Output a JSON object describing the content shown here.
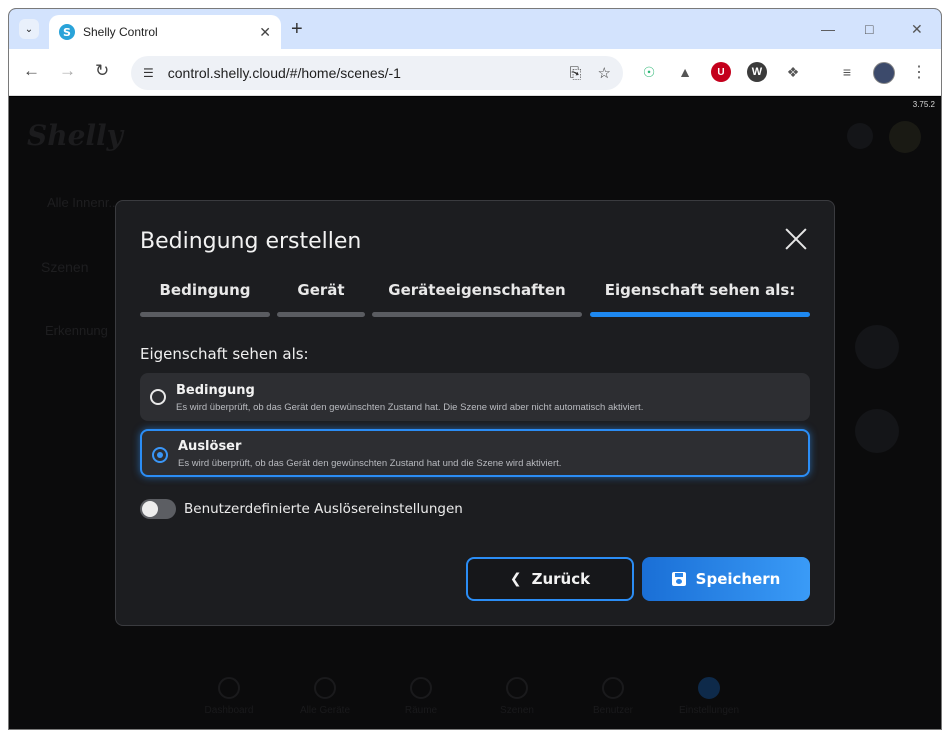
{
  "browser": {
    "tab_title": "Shelly Control",
    "url": "control.shelly.cloud/#/home/scenes/-1",
    "favicon_letter": "S"
  },
  "page": {
    "version": "3.75.2",
    "bg_logo": "Shelly",
    "bg_texts": [
      "Alle Innenr...",
      "Szenen",
      "Erkennung"
    ],
    "bg_nav": [
      "Dashboard",
      "Alle Geräte",
      "Räume",
      "Szenen",
      "Benutzer",
      "Einstellungen"
    ]
  },
  "dialog": {
    "title": "Bedingung erstellen",
    "steps": [
      {
        "label": "Bedingung",
        "active": false
      },
      {
        "label": "Gerät",
        "active": false
      },
      {
        "label": "Geräteeigenschaften",
        "active": false
      },
      {
        "label": "Eigenschaft sehen als:",
        "active": true
      }
    ],
    "section_title": "Eigenschaft sehen als:",
    "options": [
      {
        "title": "Bedingung",
        "description": "Es wird überprüft, ob das Gerät den gewünschten Zustand hat. Die Szene wird aber nicht automatisch aktiviert.",
        "selected": false
      },
      {
        "title": "Auslöser",
        "description": "Es wird überprüft, ob das Gerät den gewünschten Zustand hat und die Szene wird aktiviert.",
        "selected": true
      }
    ],
    "toggle": {
      "label": "Benutzerdefinierte Auslösereinstellungen",
      "on": false
    },
    "back_label": "Zurück",
    "save_label": "Speichern"
  },
  "colors": {
    "accent": "#2b8df5",
    "dialog_bg": "#1c1d20",
    "page_bg": "#0b0b0c"
  },
  "icons": {
    "back": "chevron-left-icon",
    "save": "floppy-disk-icon",
    "close": "close-icon"
  }
}
